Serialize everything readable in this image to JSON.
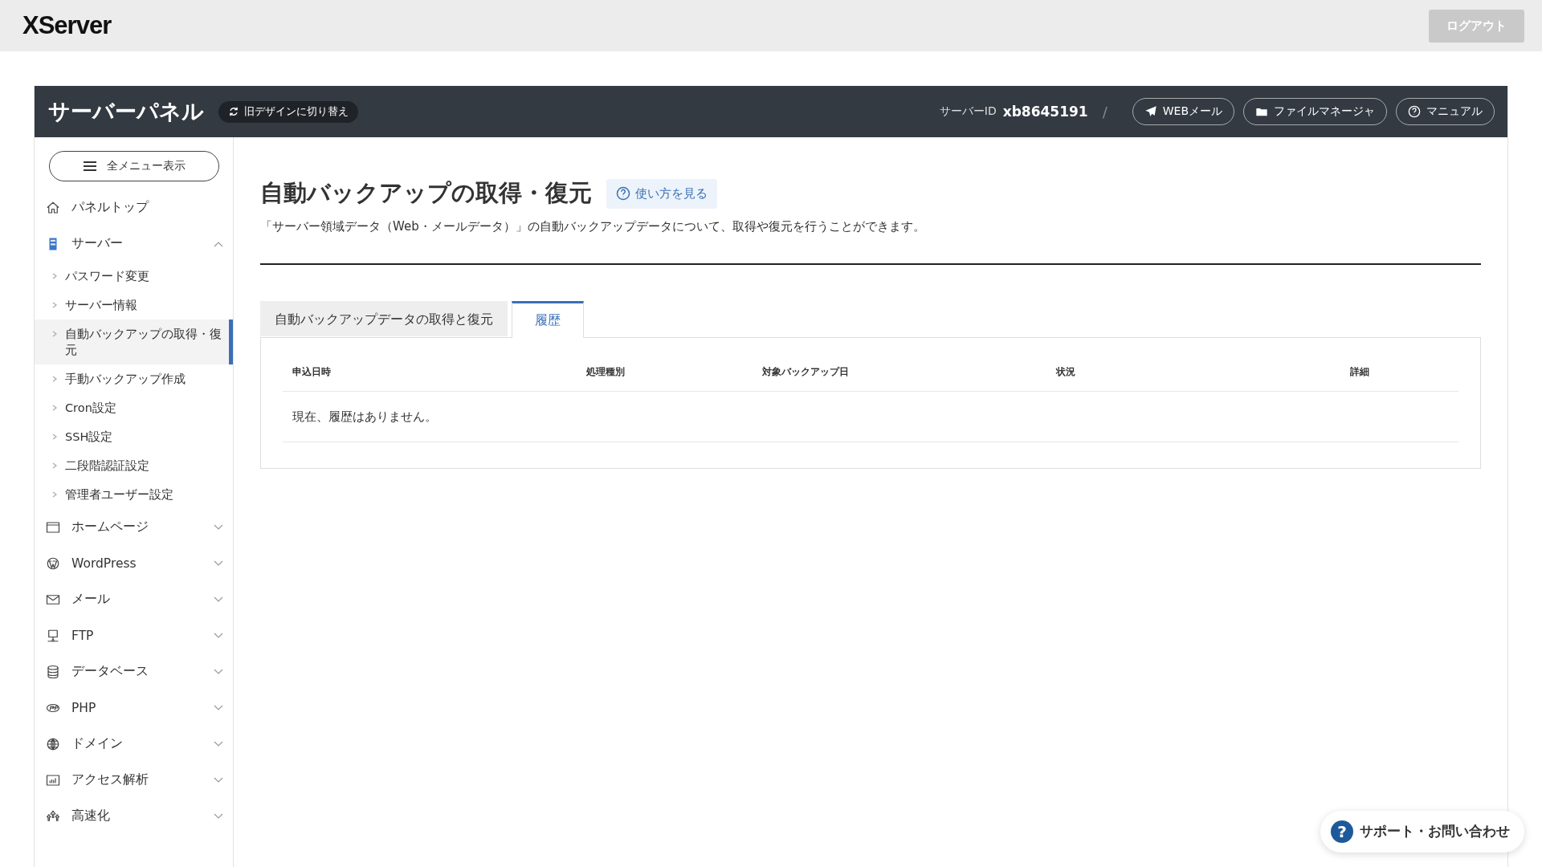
{
  "topbar": {
    "logo": "XServer",
    "logout_button": "ログアウト"
  },
  "panel_header": {
    "title": "サーバーパネル",
    "switch_button": "旧デザインに切り替え",
    "server_id_label": "サーバーID",
    "server_id": "xb8645191",
    "separator": "/",
    "links": [
      "WEBメール",
      "ファイルマネージャ",
      "マニュアル"
    ]
  },
  "sidebar": {
    "menu_button": "全メニュー表示",
    "items": [
      {
        "label": "パネルトップ"
      },
      {
        "label": "サーバー",
        "expanded": true,
        "children": [
          {
            "label": "パスワード変更",
            "selected": false
          },
          {
            "label": "サーバー情報",
            "selected": false
          },
          {
            "label": "自動バックアップの取得・復元",
            "selected": true
          },
          {
            "label": "手動バックアップ作成",
            "selected": false
          },
          {
            "label": "Cron設定",
            "selected": false
          },
          {
            "label": "SSH設定",
            "selected": false
          },
          {
            "label": "二段階認証設定",
            "selected": false
          },
          {
            "label": "管理者ユーザー設定",
            "selected": false
          }
        ]
      },
      {
        "label": "ホームページ",
        "expanded": false
      },
      {
        "label": "WordPress",
        "expanded": false
      },
      {
        "label": "メール",
        "expanded": false
      },
      {
        "label": "FTP",
        "expanded": false
      },
      {
        "label": "データベース",
        "expanded": false
      },
      {
        "label": "PHP",
        "expanded": false
      },
      {
        "label": "ドメイン",
        "expanded": false
      },
      {
        "label": "アクセス解析",
        "expanded": false
      },
      {
        "label": "高速化",
        "expanded": false
      }
    ]
  },
  "main": {
    "title": "自動バックアップの取得・復元",
    "help_link": "使い方を見る",
    "description": "「サーバー領域データ（Web・メールデータ）」の自動バックアップデータについて、取得や復元を行うことができます。",
    "tabs": [
      {
        "label": "自動バックアップデータの取得と復元",
        "selected": false
      },
      {
        "label": "履歴",
        "selected": true
      }
    ],
    "table": {
      "columns": [
        "申込日時",
        "処理種別",
        "対象バックアップ日",
        "状況",
        "詳細"
      ],
      "empty_message": "現在、履歴はありません。"
    }
  },
  "support_button": {
    "icon_text": "?",
    "label": "サポート・お問い合わせ"
  }
}
